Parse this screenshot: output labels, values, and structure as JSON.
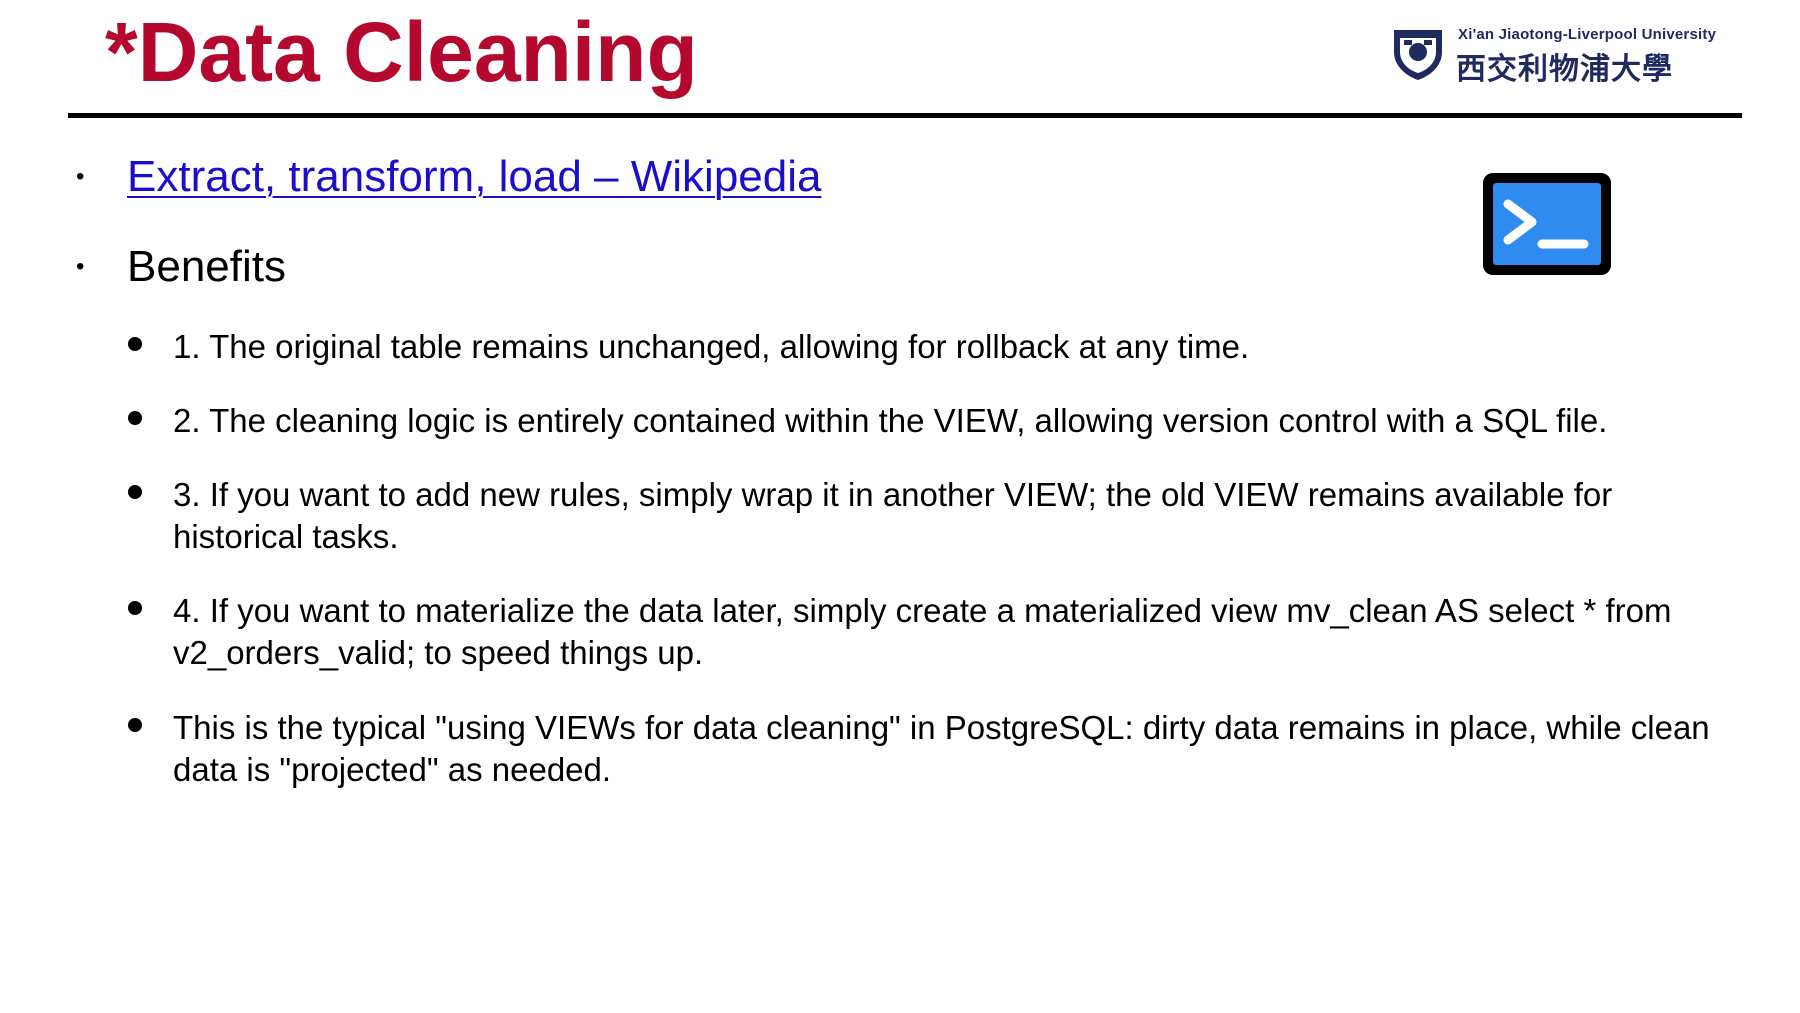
{
  "slide": {
    "title": "*Data Cleaning",
    "accent_color": "#b5082f",
    "link_color": "#1a0dcc"
  },
  "logo": {
    "en": "Xi'an Jiaotong-Liverpool University",
    "cn": "西交利物浦大學",
    "icon": "university-shield-icon"
  },
  "terminal_icon": {
    "name": "terminal-icon",
    "color": "#2f8bf0"
  },
  "bullets": [
    {
      "text": "Extract, transform, load – Wikipedia",
      "is_link": true
    },
    {
      "text": "Benefits",
      "is_link": false
    }
  ],
  "benefits": [
    "1. The original table remains unchanged, allowing for rollback at any time.",
    "2. The cleaning logic is entirely contained within the VIEW, allowing version control with a SQL file.",
    "3. If you want to add new rules, simply wrap it in another VIEW; the old VIEW remains available for historical tasks.",
    "4. If you want to materialize the data later, simply create a materialized view mv_clean AS select * from v2_orders_valid; to speed things up.",
    "This is the typical \"using VIEWs for data cleaning\" in PostgreSQL: dirty data remains in place, while clean data is \"projected\" as needed."
  ]
}
